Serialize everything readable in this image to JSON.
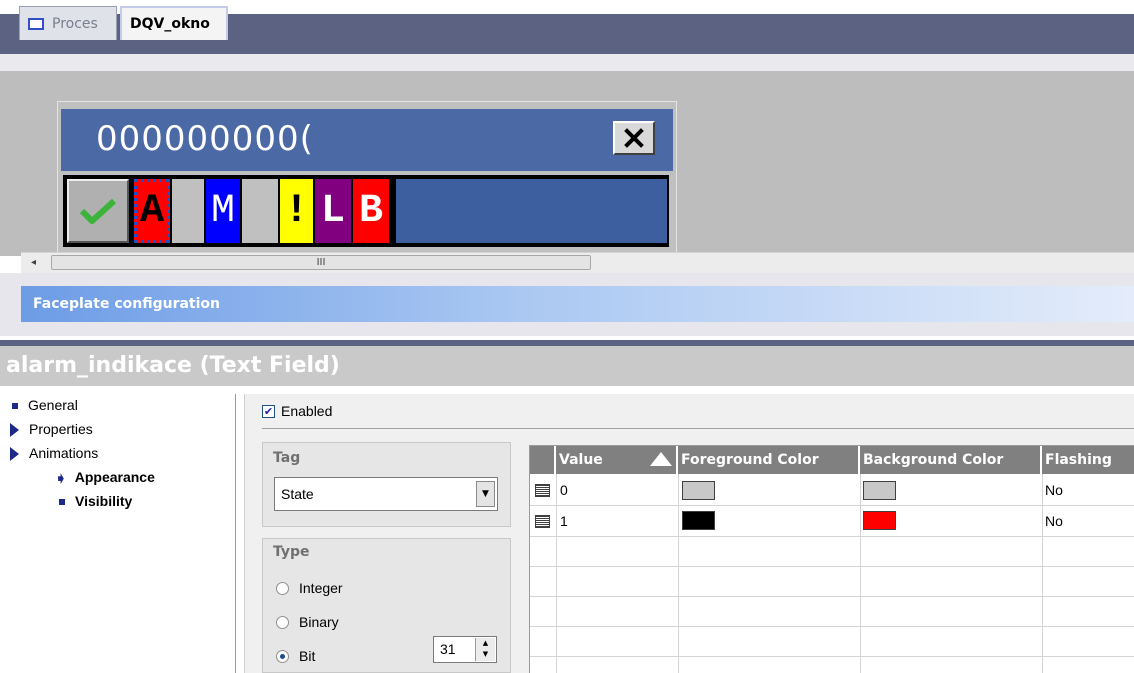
{
  "tabs": [
    {
      "label": "Proces",
      "active": false
    },
    {
      "label": "DQV_okno",
      "active": true
    }
  ],
  "faceplate": {
    "title_value": "000000000(",
    "close_label": "X",
    "indicators": [
      "A",
      "M",
      "!",
      "L",
      "B"
    ],
    "colors": {
      "title_bar": "#4b69a4",
      "a": "#ff0000",
      "m": "#0000ff",
      "excl": "#ffff00",
      "l": "#800080",
      "b": "#ff0000"
    }
  },
  "scrollbar": {
    "left_arrow": "◂",
    "grip": "III"
  },
  "config_header": "Faceplate configuration",
  "properties_title": "alarm_indikace (Text Field)",
  "tree": [
    {
      "label": "General"
    },
    {
      "label": "Properties"
    },
    {
      "label": "Animations"
    },
    {
      "label": "Appearance"
    },
    {
      "label": "Visibility"
    }
  ],
  "enabled": {
    "label": "Enabled",
    "checked": true
  },
  "tag": {
    "heading": "Tag",
    "value": "State"
  },
  "type": {
    "heading": "Type",
    "options": [
      "Integer",
      "Binary",
      "Bit"
    ],
    "selected": "Bit",
    "bit_value": "31"
  },
  "table": {
    "columns": [
      "Value",
      "Foreground Color",
      "Background Color",
      "Flashing"
    ],
    "rows": [
      {
        "value": "0",
        "foreground": "#c8c8c8",
        "background": "#c8c8c8",
        "flashing": "No"
      },
      {
        "value": "1",
        "foreground": "#000000",
        "background": "#ff0000",
        "flashing": "No"
      }
    ]
  }
}
